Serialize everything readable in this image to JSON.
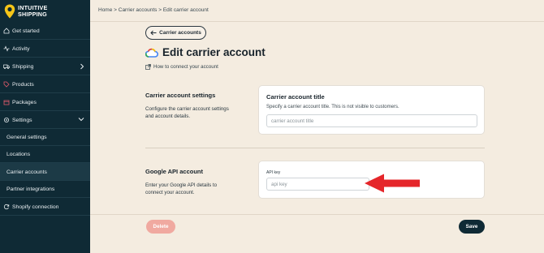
{
  "brand": {
    "line1": "INTUITIVE",
    "line2": "SHIPPING",
    "logo_icon": "location-pin-icon",
    "accent": "#f5c518"
  },
  "sidebar": {
    "items": [
      {
        "label": "Get started",
        "icon": "home-icon"
      },
      {
        "label": "Activity",
        "icon": "activity-icon"
      },
      {
        "label": "Shipping",
        "icon": "truck-icon"
      },
      {
        "label": "Products",
        "icon": "tag-icon"
      },
      {
        "label": "Packages",
        "icon": "box-icon"
      },
      {
        "label": "Settings",
        "icon": "gear-icon"
      },
      {
        "label": "General settings"
      },
      {
        "label": "Locations"
      },
      {
        "label": "Carrier accounts"
      },
      {
        "label": "Partner integrations"
      },
      {
        "label": "Shopify connection",
        "icon": "refresh-icon"
      }
    ]
  },
  "breadcrumb": "Home > Carrier accounts > Edit carrier account",
  "back_button": "Carrier accounts",
  "page_title": "Edit carrier account",
  "howto_link": "How to connect your account",
  "section1": {
    "title": "Carrier account settings",
    "desc": "Configure the carrier account settings and account details.",
    "card_title": "Carrier account title",
    "card_help": "Specify a carrier account title. This is not visible to customers.",
    "input_placeholder": "carrier account title"
  },
  "section2": {
    "title": "Google API account",
    "desc": "Enter your Google API details to connect your account.",
    "field_label": "API key",
    "input_placeholder": "api key"
  },
  "footer": {
    "delete": "Delete",
    "save": "Save"
  },
  "colors": {
    "sidebar_bg": "#0f2a35",
    "page_bg": "#f4ece0",
    "arrow": "#e5262a",
    "delete_bg": "#f0a9a0"
  }
}
